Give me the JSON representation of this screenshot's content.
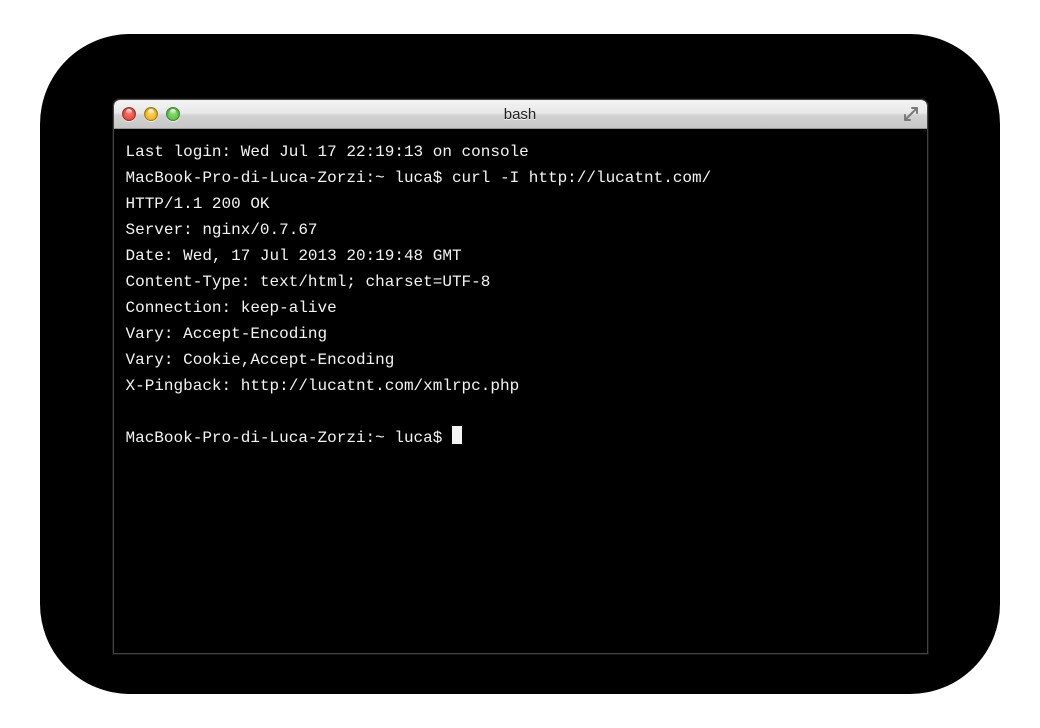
{
  "window": {
    "title": "bash"
  },
  "terminal": {
    "lines": [
      "Last login: Wed Jul 17 22:19:13 on console",
      "MacBook-Pro-di-Luca-Zorzi:~ luca$ curl -I http://lucatnt.com/",
      "HTTP/1.1 200 OK",
      "Server: nginx/0.7.67",
      "Date: Wed, 17 Jul 2013 20:19:48 GMT",
      "Content-Type: text/html; charset=UTF-8",
      "Connection: keep-alive",
      "Vary: Accept-Encoding",
      "Vary: Cookie,Accept-Encoding",
      "X-Pingback: http://lucatnt.com/xmlrpc.php",
      "",
      "MacBook-Pro-di-Luca-Zorzi:~ luca$ "
    ]
  }
}
